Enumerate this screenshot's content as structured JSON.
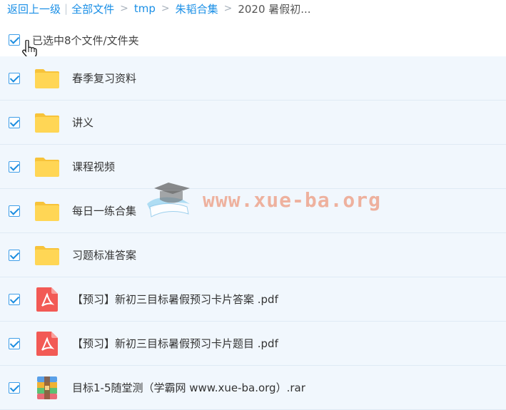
{
  "breadcrumb": {
    "back": "返回上一级",
    "all_files": "全部文件",
    "tmp": "tmp",
    "collection": "朱韬合集",
    "current": "2020 暑假初..."
  },
  "selection": {
    "label": "已选中8个文件/文件夹"
  },
  "files": [
    {
      "name": "春季复习资料",
      "type": "folder",
      "checked": true
    },
    {
      "name": "讲义",
      "type": "folder",
      "checked": true
    },
    {
      "name": "课程视频",
      "type": "folder",
      "checked": true
    },
    {
      "name": "每日一练合集",
      "type": "folder",
      "checked": true
    },
    {
      "name": "习题标准答案",
      "type": "folder",
      "checked": true
    },
    {
      "name": "【预习】新初三目标暑假预习卡片答案 .pdf",
      "type": "pdf",
      "checked": true
    },
    {
      "name": "【预习】新初三目标暑假预习卡片题目 .pdf",
      "type": "pdf",
      "checked": true
    },
    {
      "name": "目标1-5随堂测（学霸网 www.xue-ba.org）.rar",
      "type": "rar",
      "checked": true
    }
  ],
  "watermark": {
    "text": "www.xue-ba.org"
  },
  "colors": {
    "link": "#1a8fe6",
    "row_bg": "#f1f7fd",
    "folder": "#ffd34f",
    "pdf": "#f25a55"
  }
}
